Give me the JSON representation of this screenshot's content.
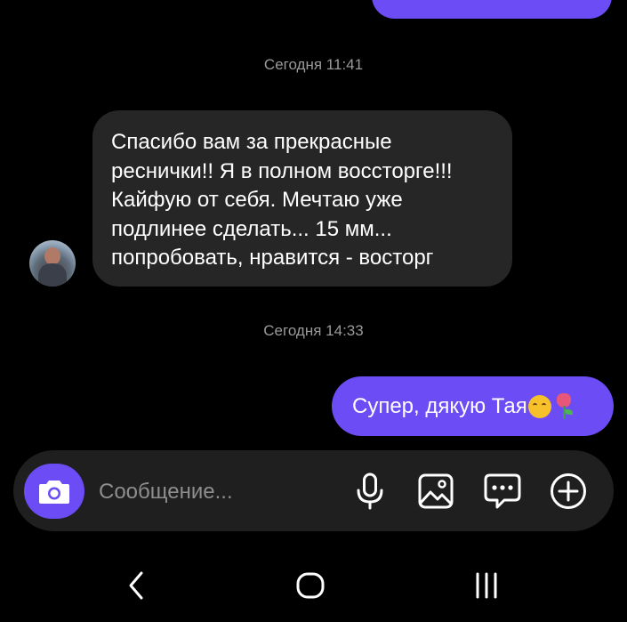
{
  "conversation": {
    "timestamps": [
      "Сегодня 11:41",
      "Сегодня 14:33"
    ],
    "incoming_message": "Спасибо вам за прекрасные\nреснички!! Я в полном воссторге!!!\nКайфую от себя. Мечтаю уже\nподлинее сделать... 15 мм...\nпопробовать, нравится - восторг",
    "outgoing_message": {
      "text": "Супер, дякую Тая",
      "emojis": [
        "smiling-face",
        "tulip"
      ]
    }
  },
  "composer": {
    "placeholder": "Сообщение...",
    "icons": [
      "camera-icon",
      "microphone-icon",
      "gallery-icon",
      "sticker-icon",
      "plus-icon"
    ]
  },
  "navigation": {
    "icons": [
      "back-icon",
      "home-icon",
      "recent-apps-icon"
    ]
  },
  "colors": {
    "background": "#000000",
    "outgoing_bubble": "#6b4cf5",
    "incoming_bubble": "#262626",
    "composer_bar": "#1f1f1f",
    "timestamp_text": "#9a9a9a",
    "icon": "#ffffff"
  }
}
